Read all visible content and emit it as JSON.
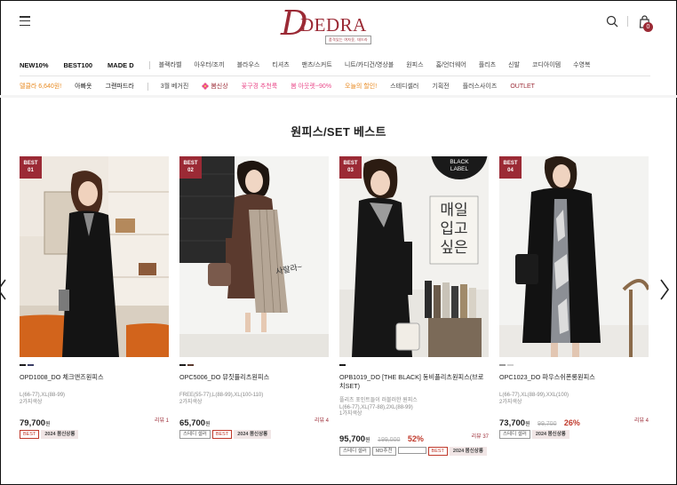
{
  "brand": {
    "name": "DEDRA",
    "initial": "D",
    "tagline": "품격있는 여자옷, 데드라"
  },
  "cart": {
    "count": "0"
  },
  "main_nav": {
    "primary": [
      "NEW10%",
      "BEST100",
      "MADE D"
    ],
    "categories": [
      "블랙라벨",
      "아우터/조끼",
      "블라우스",
      "티셔츠",
      "팬츠/스커트",
      "니트/카디건/영상블",
      "원피스",
      "홈/언더웨어",
      "플리츠",
      "신발",
      "코디아이템",
      "수영복"
    ]
  },
  "sub_nav": {
    "group1": [
      "델클라 6,640원!",
      "아빠옷",
      "그랜파드라"
    ],
    "group2": [
      "3월 베거진",
      "봄신상",
      "꽃구경 추천룩",
      "봄 아웃렛~90%",
      "오늘의 할인!",
      "스테디셀러",
      "기획전",
      "플러스사이즈",
      "OUTLET"
    ]
  },
  "section": {
    "title": "원피스/SET 베스트"
  },
  "products": [
    {
      "badge_top": "BEST",
      "badge_num": "01",
      "name": "OPD1008_DO 체크앤즈원피스",
      "sizes": [
        "L(66-77),XL(88-99)",
        "2가지색상"
      ],
      "price": "79,700",
      "won": "원",
      "original": "",
      "discount": "",
      "review": "리뷰 1",
      "tags": [
        "BEST",
        "2024 봄신상롱"
      ],
      "swatches": [
        "#1d1d1d",
        "#3b3f66"
      ]
    },
    {
      "badge_top": "BEST",
      "badge_num": "02",
      "name": "OPC5006_DO 뮤짓플리츠원피스",
      "sizes": [
        "FREE(55-77),L(88-99),XL(100-110)",
        "2가지색상"
      ],
      "price": "65,700",
      "won": "원",
      "original": "",
      "discount": "",
      "review": "리뷰 4",
      "tags": [
        "스테디 셀러",
        "BEST",
        "2024 봄신상롱"
      ],
      "swatches": [
        "#1d1d1d",
        "#5b3a2e"
      ]
    },
    {
      "badge_top": "BEST",
      "badge_num": "03",
      "name": "OPB1019_DO [THE BLACK] 동비플리츠원피스(브로치SET)",
      "sizes": [
        "플리츠 포인트들이 러블러한 원피스",
        "L(66-77),XL(77-88),2XL(88-99)",
        "1가지색상"
      ],
      "price": "95,700",
      "won": "원",
      "original": "199,000",
      "discount": "52%",
      "review": "리뷰 37",
      "tags": [
        "스테디 셀러",
        "MD추천",
        "",
        "BEST",
        "2024 봄신상롱"
      ],
      "swatches": [
        "#1d1d1d"
      ],
      "black_label": [
        "BLACK",
        "LABEL"
      ],
      "overlay_text": [
        "매일",
        "입고",
        "싶은"
      ]
    },
    {
      "badge_top": "BEST",
      "badge_num": "04",
      "name": "OPC1023_DO 파우스쉬폰롱원피스",
      "sizes": [
        "L(66-77),XL(88-99),XXL(100)",
        "2가지색상"
      ],
      "price": "73,700",
      "won": "원",
      "original": "99,700",
      "discount": "26%",
      "review": "리뷰 4",
      "tags": [
        "스테디 셀러",
        "2024 봄신상롱"
      ],
      "swatches": [
        "#9a9a9a",
        "#cfcfcf"
      ]
    }
  ],
  "photo_captions": {
    "p2": "사랄라~"
  },
  "colors": {
    "brand": "#9b2a35",
    "discount": "#c0392b",
    "sale_text": "#e8891f",
    "promo_pink": "#e94a8a"
  }
}
